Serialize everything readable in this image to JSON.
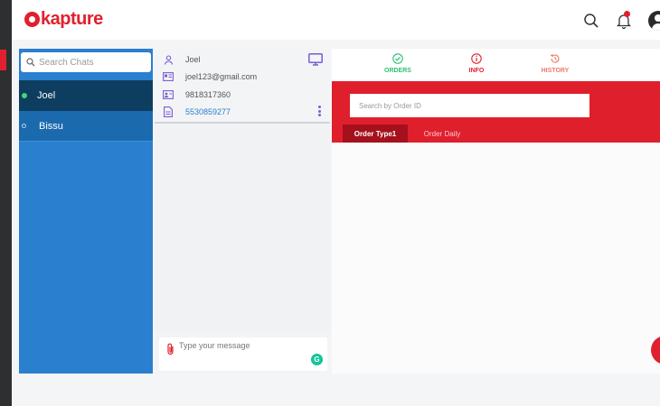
{
  "app": {
    "logo_text": "kapture",
    "brand_color": "#e0202e",
    "accent_blue": "#2a7fcf"
  },
  "header": {
    "icons": [
      "search-icon",
      "bell-icon",
      "user-avatar-icon"
    ]
  },
  "chat_list": {
    "search_placeholder": "Search Chats",
    "items": [
      {
        "name": "Joel",
        "status": "online"
      },
      {
        "name": "Bissu",
        "status": "offline"
      }
    ]
  },
  "customer": {
    "name": "Joel",
    "email": "joel123@gmail.com",
    "phone": "9818317360",
    "ticket_id": "5530859277"
  },
  "composer": {
    "placeholder": "Type your message",
    "grammarly_badge": "G"
  },
  "order_panel": {
    "tabs": [
      {
        "label": "ORDERS",
        "color": "#2fbf71",
        "icon": "check-circle-icon"
      },
      {
        "label": "INFO",
        "color": "#e0202e",
        "icon": "info-circle-icon"
      },
      {
        "label": "HISTORY",
        "color": "#f0796b",
        "icon": "history-icon"
      }
    ],
    "search_placeholder": "Search by Order ID",
    "sub_tabs": [
      {
        "label": "Order Type1",
        "active": true
      },
      {
        "label": "Order Daily",
        "active": false
      }
    ]
  }
}
